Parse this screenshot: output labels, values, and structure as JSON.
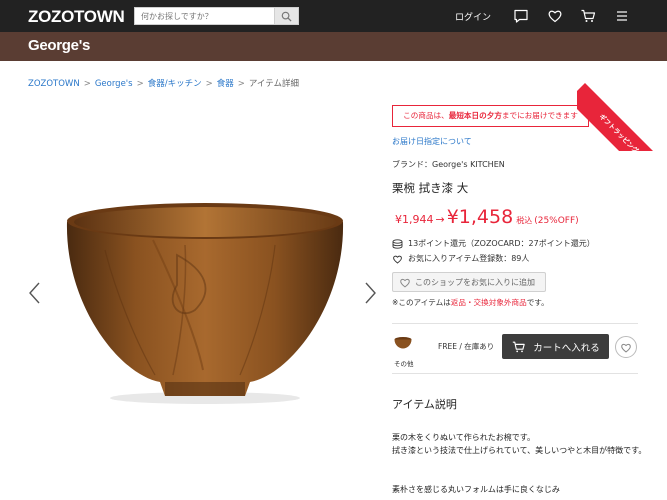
{
  "header": {
    "logo": "ZOZOTOWN",
    "search_placeholder": "何かお探しですか？",
    "login": "ログイン",
    "icons": [
      "search-icon",
      "message-icon",
      "heart-icon",
      "cart-icon",
      "menu-icon"
    ]
  },
  "shop": {
    "name": "George's"
  },
  "ribbon": {
    "text": "ギフトラッピングOK"
  },
  "breadcrumb": [
    "ZOZOTOWN",
    "George's",
    "食器/キッチン",
    "食器",
    "アイテム詳細"
  ],
  "product": {
    "notice_pre": "この商品は、",
    "notice_bold": "最短本日の夕方",
    "notice_post": "までにお届けできます",
    "delivery_link": "お届け日指定について",
    "brand": "ブランド：George's KITCHEN",
    "title": "栗椀 拭き漆 大",
    "old_price": "¥1,944",
    "arrow": "→",
    "new_price": "¥1,458",
    "tax": "税込",
    "discount": "(25%OFF)",
    "points": "13ポイント還元（ZOZOCARD：27ポイント還元）",
    "favorites": "お気に入りアイテム登録数：89人",
    "shop_fav_button": "このショップをお気に入りに追加",
    "return_pre": "※このアイテムは",
    "return_red": "返品・交換対象外商品",
    "return_post": "です。"
  },
  "sku": {
    "color_label": "その他",
    "size_stock": "FREE / 在庫あり",
    "cart_button": "カートへ入れる"
  },
  "description": {
    "heading": "アイテム説明",
    "lines": [
      "栗の木をくりぬいて作られたお椀です。",
      "拭き漆という技法で仕上げられていて、美しいつやと木目が特徴です。",
      "素朴さを感じる丸いフォルムは手に良くなじみ"
    ]
  },
  "colors": {
    "accent": "#e8253a",
    "header": "#222222",
    "shopbar": "#5a3d33",
    "link": "#2a77c9"
  }
}
